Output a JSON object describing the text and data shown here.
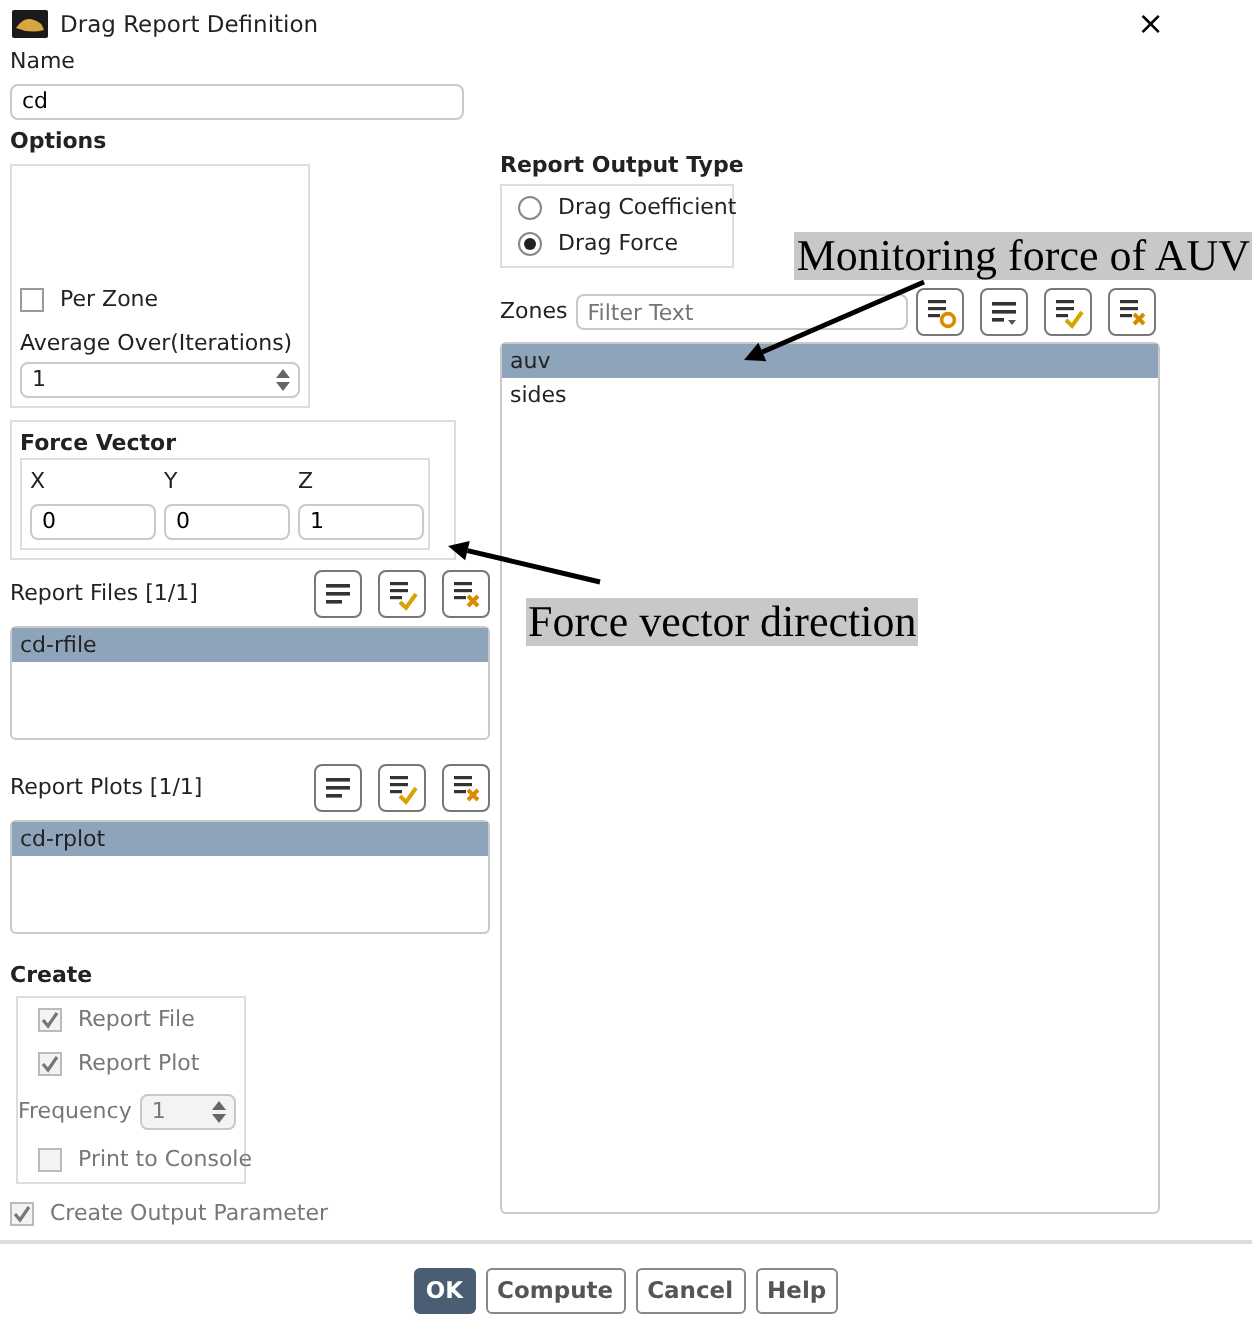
{
  "window": {
    "title": "Drag Report Definition",
    "close": "×"
  },
  "name": {
    "label": "Name",
    "value": "cd"
  },
  "options": {
    "label": "Options",
    "per_zone": {
      "label": "Per Zone",
      "checked": false
    },
    "average_over": {
      "label": "Average Over(Iterations)",
      "value": "1"
    }
  },
  "force_vector": {
    "label": "Force Vector",
    "components": [
      {
        "label": "X",
        "value": "0"
      },
      {
        "label": "Y",
        "value": "0"
      },
      {
        "label": "Z",
        "value": "1"
      }
    ]
  },
  "report_files": {
    "label": "Report Files [1/1]",
    "items": [
      {
        "label": "cd-rfile",
        "selected": true
      }
    ]
  },
  "report_plots": {
    "label": "Report Plots [1/1]",
    "items": [
      {
        "label": "cd-rplot",
        "selected": true
      }
    ]
  },
  "create": {
    "label": "Create",
    "items": [
      {
        "kind": "checkbox",
        "label": "Report File",
        "checked": true,
        "disabled": true
      },
      {
        "kind": "checkbox",
        "label": "Report Plot",
        "checked": true,
        "disabled": true
      },
      {
        "kind": "spinner",
        "label": "Frequency",
        "value": "1",
        "disabled": true
      },
      {
        "kind": "checkbox",
        "label": "Print to Console",
        "checked": false,
        "disabled": true
      }
    ]
  },
  "create_output_parameter": {
    "label": "Create Output Parameter",
    "checked": true,
    "disabled": true
  },
  "report_output_type": {
    "label": "Report Output Type",
    "options": [
      {
        "label": "Drag Coefficient",
        "selected": false
      },
      {
        "label": "Drag Force",
        "selected": true
      }
    ]
  },
  "zones": {
    "label": "Zones",
    "filter": {
      "placeholder": "Filter Text"
    },
    "items": [
      {
        "label": "auv",
        "selected": true
      },
      {
        "label": "sides",
        "selected": false
      }
    ]
  },
  "buttons": [
    {
      "label": "OK",
      "default": true
    },
    {
      "label": "Compute",
      "default": false
    },
    {
      "label": "Cancel",
      "default": false
    },
    {
      "label": "Help",
      "default": false
    }
  ],
  "annotations": [
    {
      "text": "Monitoring force of AUV"
    },
    {
      "text": "Force vector direction"
    }
  ]
}
